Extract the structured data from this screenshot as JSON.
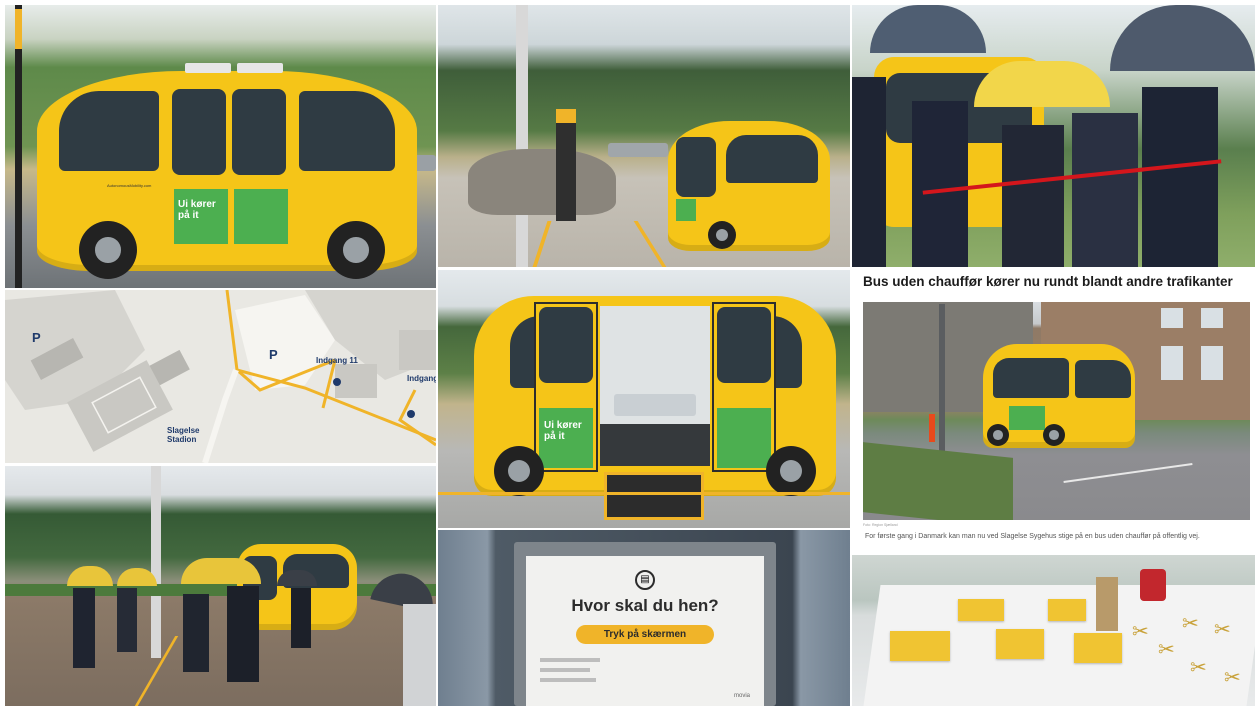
{
  "collage": {
    "bus_wrap_text": "Ui kører på it",
    "bus_side_url": "AutonomousMobility.com",
    "map": {
      "parking_label": "P",
      "entrance_1": "Indgang 11",
      "entrance_2": "Indgang",
      "stadium_label_line1": "Slagelse",
      "stadium_label_line2": "Stadion"
    },
    "article": {
      "headline": "Bus uden chauffør kører nu rundt blandt andre trafikanter",
      "credit": "Foto: Region Sjælland",
      "caption": "For første gang i Danmark kan man nu ved Slagelse Sygehus stige på en bus uden chauffør på offentlig vej."
    },
    "sign": {
      "question": "Hvor skal du hen?",
      "button_label": "Tryk på skærmen",
      "brand": "movia"
    },
    "colors": {
      "bus_yellow": "#f5c518",
      "wrap_green": "#4caf50",
      "map_route": "#f0b429",
      "map_text": "#1f3a6b"
    }
  }
}
